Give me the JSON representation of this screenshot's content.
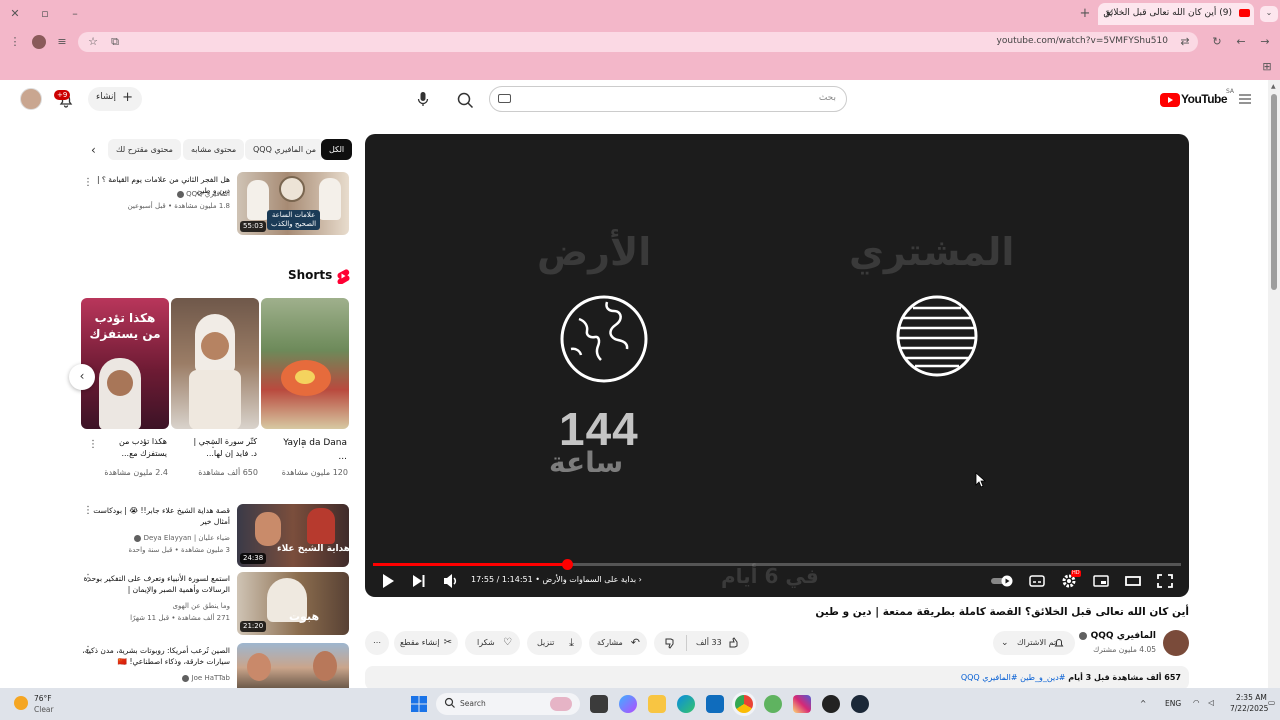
{
  "browser": {
    "tab_title": "(9) أين كان الله تعالى قبل الخلائق",
    "tab_close": "×",
    "new_tab": "+",
    "url": "youtube.com/watch?v=5VMFYShu510"
  },
  "yt_header": {
    "logo_text": "YouTube",
    "logo_region": "SA",
    "search_placeholder": "بحث",
    "create_label": "إنشاء",
    "notification_count": "+9"
  },
  "chips": [
    {
      "label": "الكل",
      "active": true
    },
    {
      "label": "من المافيري QQQ",
      "active": false
    },
    {
      "label": "محتوى مشابه",
      "active": false
    },
    {
      "label": "محتوى مقترح لك",
      "active": false
    }
  ],
  "player": {
    "ghost_left": "الأرض",
    "ghost_right": "المشتري",
    "big_number": "144",
    "big_word": "ساعة",
    "bottom_caption": "في 6 أيام",
    "time_current": "17:55",
    "time_total": "1:14:51",
    "chapter": "بداية على السماوات والأرض",
    "progress": 0.24
  },
  "video": {
    "title": "أين كان الله تعالى قبل الخلائق؟ القصة كاملة بطريقة ممتعة | دين و طين",
    "channel_name": "المافيري QQQ",
    "subscribers": "4.05 مليون مشترك",
    "subscribe_label": "تم الاشتراك",
    "likes": "33 ألف",
    "share_label": "مشاركة",
    "download_label": "تنزيل",
    "thanks_label": "شكرا",
    "clip_label": "إنشاء مقطع",
    "description_meta": "657 ألف مشاهدة قبل 3 أيام",
    "description_tags": "#دين_و_طين #المافيري QQQ"
  },
  "sidebar": {
    "top_video": {
      "title": "هل الفجر الثاني من علامات يوم القيامة ؟ | دين و طين",
      "channel": "المافيري QQQ",
      "meta": "1.8 مليون مشاهدة • قبل أسبوعين",
      "duration": "55:03",
      "thumb_text_1": "علامات الساعة",
      "thumb_text_2": "الصحيح والكذب"
    },
    "shorts_heading": "Shorts",
    "shorts": [
      {
        "title": "Yayla da Dana ...",
        "views": "120 مليون مشاهدة"
      },
      {
        "title": "كتّر سورة السجي | د. فايد إن لها...",
        "views": "650 ألف مشاهدة"
      },
      {
        "title": "هكذا تؤدب من يستفزك مع...",
        "views": "2.4 مليون مشاهدة",
        "overlay_1": "هكذا تؤدب",
        "overlay_2": "من يستفزك"
      }
    ],
    "videos": [
      {
        "title": "قصة هداية الشيخ علاء جابر!! 😭 | بودكاست أمثال خير",
        "channel": "Deya Elayyan",
        "channel_sub": "ضياء علیان |",
        "meta": "3 مليون مشاهدة • قبل سنة واحدة",
        "duration": "24:38",
        "thumb_text": "قصة هداية الشيخ علاء"
      },
      {
        "title": "استمع لسورة الأنبياء وتعرف على التفكير بوحدة الرسالات وأهمية الصبر والإيمان |",
        "channel": "وما ينطق عن الهوى",
        "meta": "271 ألف مشاهدة • قبل 11 شهرًا",
        "duration": "21:20",
        "thumb_text": "هبوت"
      },
      {
        "title": "الصين تُرعب أمريكا: روبوتات بشرية، مدن ذكية، سيارات خارقة، وذكاء اصطناعي! 🇨🇳",
        "channel": "Joe HaTTab",
        "meta": "",
        "duration": "",
        "thumb_text": ""
      }
    ]
  },
  "taskbar": {
    "weather_temp": "76°F",
    "weather_desc": "Clear",
    "search_label": "Search",
    "lang": "ENG",
    "time": "2:35 AM",
    "date": "7/22/2025"
  },
  "colors": {
    "chrome_bg": "#f3b7c9",
    "yt_red": "#ff0000",
    "player_bg": "#1c1c1c"
  }
}
